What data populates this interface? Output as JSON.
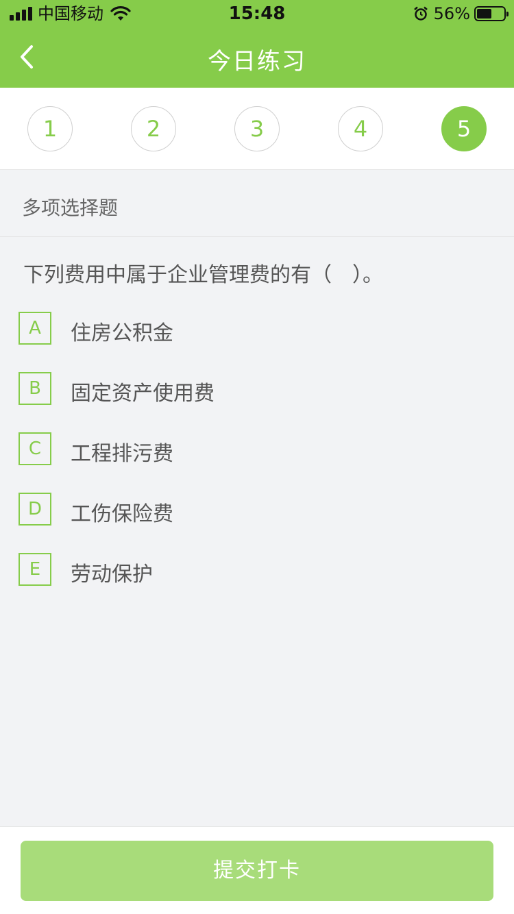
{
  "status_bar": {
    "carrier": "中国移动",
    "time": "15:48",
    "battery_percent": "56%",
    "battery_level": 0.56,
    "icons": [
      "signal-icon",
      "wifi-icon",
      "alarm-icon",
      "battery-icon"
    ]
  },
  "nav": {
    "title": "今日练习",
    "back_icon": "chevron-left-icon"
  },
  "question_nav": {
    "numbers": [
      "1",
      "2",
      "3",
      "4",
      "5"
    ],
    "active_index": 4
  },
  "question": {
    "type": "多项选择题",
    "text": "下列费用中属于企业管理费的有（　）。",
    "options": [
      {
        "letter": "A",
        "text": "住房公积金"
      },
      {
        "letter": "B",
        "text": "固定资产使用费"
      },
      {
        "letter": "C",
        "text": "工程排污费"
      },
      {
        "letter": "D",
        "text": "工伤保险费"
      },
      {
        "letter": "E",
        "text": "劳动保护"
      }
    ]
  },
  "footer": {
    "submit_label": "提交打卡"
  },
  "colors": {
    "brand_green": "#86cc4a",
    "submit_disabled_green": "#a8dc7a",
    "page_background": "#f2f3f5"
  }
}
